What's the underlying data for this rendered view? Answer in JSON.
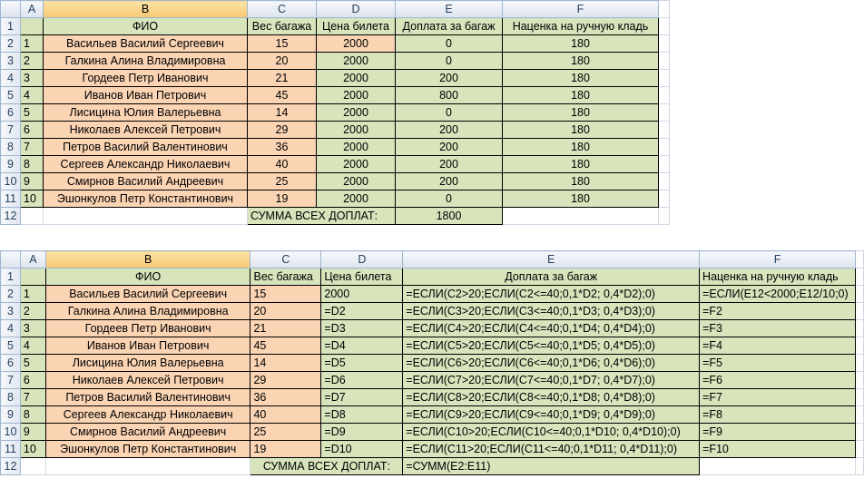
{
  "sheet1": {
    "columns": [
      "A",
      "B",
      "C",
      "D",
      "E",
      "F"
    ],
    "headers": [
      "",
      "ФИО",
      "Вес багажа",
      "Цена билета",
      "Доплата за багаж",
      "Наценка на ручную кладь"
    ],
    "rows": [
      [
        "1",
        "Васильев Василий Сергеевич",
        "15",
        "2000",
        "0",
        "180"
      ],
      [
        "2",
        "Галкина Алина Владимировна",
        "20",
        "2000",
        "0",
        "180"
      ],
      [
        "3",
        "Гордеев Петр Иванович",
        "21",
        "2000",
        "200",
        "180"
      ],
      [
        "4",
        "Иванов Иван Петрович",
        "45",
        "2000",
        "800",
        "180"
      ],
      [
        "5",
        "Лисицина Юлия Валерьевна",
        "14",
        "2000",
        "0",
        "180"
      ],
      [
        "6",
        "Николаев Алексей Петрович",
        "29",
        "2000",
        "200",
        "180"
      ],
      [
        "7",
        "Петров Василий Валентинович",
        "36",
        "2000",
        "200",
        "180"
      ],
      [
        "8",
        "Сергеев Александр Николаевич",
        "40",
        "2000",
        "200",
        "180"
      ],
      [
        "9",
        "Смирнов Василий Андреевич",
        "25",
        "2000",
        "200",
        "180"
      ],
      [
        "10",
        "Эшонкулов Петр Константинович",
        "19",
        "2000",
        "0",
        "180"
      ]
    ],
    "total_label": "СУММА ВСЕХ ДОПЛАТ:",
    "total_value": "1800",
    "row_numbers": [
      "1",
      "2",
      "3",
      "4",
      "5",
      "6",
      "7",
      "8",
      "9",
      "10",
      "11",
      "12"
    ]
  },
  "sheet2": {
    "columns": [
      "A",
      "B",
      "C",
      "D",
      "E",
      "F"
    ],
    "headers": [
      "",
      "ФИО",
      "Вес багажа",
      "Цена билета",
      "Доплата за багаж",
      "Наценка на ручную кладь"
    ],
    "rows": [
      [
        "1",
        "Васильев Василий Сергеевич",
        "15",
        "2000",
        "=ЕСЛИ(C2>20;ЕСЛИ(C2<=40;0,1*D2; 0,4*D2);0)",
        "=ЕСЛИ(E12<2000;E12/10;0)"
      ],
      [
        "2",
        "Галкина Алина Владимировна",
        "20",
        "=D2",
        "=ЕСЛИ(C3>20;ЕСЛИ(C3<=40;0,1*D3; 0,4*D3);0)",
        "=F2"
      ],
      [
        "3",
        "Гордеев Петр Иванович",
        "21",
        "=D3",
        "=ЕСЛИ(C4>20;ЕСЛИ(C4<=40;0,1*D4; 0,4*D4);0)",
        "=F3"
      ],
      [
        "4",
        "Иванов Иван Петрович",
        "45",
        "=D4",
        "=ЕСЛИ(C5>20;ЕСЛИ(C5<=40;0,1*D5; 0,4*D5);0)",
        "=F4"
      ],
      [
        "5",
        "Лисицина Юлия Валерьевна",
        "14",
        "=D5",
        "=ЕСЛИ(C6>20;ЕСЛИ(C6<=40;0,1*D6; 0,4*D6);0)",
        "=F5"
      ],
      [
        "6",
        "Николаев Алексей Петрович",
        "29",
        "=D6",
        "=ЕСЛИ(C7>20;ЕСЛИ(C7<=40;0,1*D7; 0,4*D7);0)",
        "=F6"
      ],
      [
        "7",
        "Петров Василий Валентинович",
        "36",
        "=D7",
        "=ЕСЛИ(C8>20;ЕСЛИ(C8<=40;0,1*D8; 0,4*D8);0)",
        "=F7"
      ],
      [
        "8",
        "Сергеев Александр Николаевич",
        "40",
        "=D8",
        "=ЕСЛИ(C9>20;ЕСЛИ(C9<=40;0,1*D9; 0,4*D9);0)",
        "=F8"
      ],
      [
        "9",
        "Смирнов Василий Андреевич",
        "25",
        "=D9",
        "=ЕСЛИ(C10>20;ЕСЛИ(C10<=40;0,1*D10; 0,4*D10);0)",
        "=F9"
      ],
      [
        "10",
        "Эшонкулов Петр Константинович",
        "19",
        "=D10",
        "=ЕСЛИ(C11>20;ЕСЛИ(C11<=40;0,1*D11; 0,4*D11);0)",
        "=F10"
      ]
    ],
    "total_label": "СУММА ВСЕХ ДОПЛАТ:",
    "total_value": "=СУММ(E2:E11)",
    "row_numbers": [
      "1",
      "2",
      "3",
      "4",
      "5",
      "6",
      "7",
      "8",
      "9",
      "10",
      "11",
      "12"
    ]
  }
}
